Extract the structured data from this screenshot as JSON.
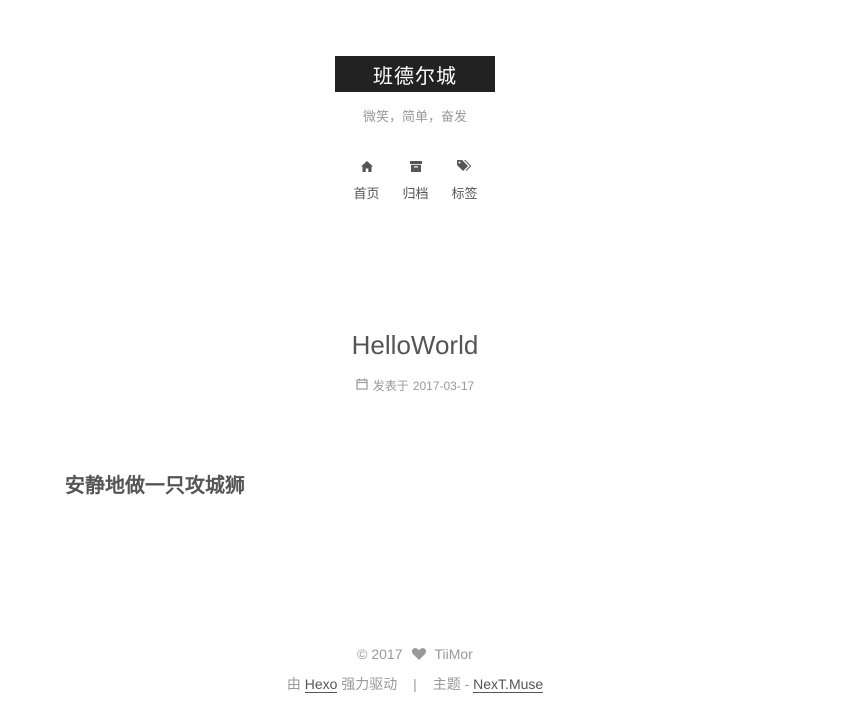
{
  "header": {
    "site_title": "班德尔城",
    "subtitle": "微笑，简单，奋发",
    "title_bg_color": "#222222"
  },
  "menu": {
    "items": [
      {
        "label": "首页",
        "icon": "home-icon"
      },
      {
        "label": "归档",
        "icon": "archive-icon"
      },
      {
        "label": "标签",
        "icon": "tags-icon"
      }
    ]
  },
  "post": {
    "title": "HelloWorld",
    "meta_icon": "calendar-icon",
    "meta_label": "发表于",
    "date": "2017-03-17",
    "heading": "安静地做一只攻城狮"
  },
  "footer": {
    "copyright": "© 2017",
    "heart_icon": "heart-icon",
    "author": "TiiMor",
    "powered_prefix": "由",
    "powered_link": "Hexo",
    "powered_suffix": "强力驱动",
    "separator": "|",
    "theme_prefix": "主题 -",
    "theme_link": "NexT.Muse"
  }
}
